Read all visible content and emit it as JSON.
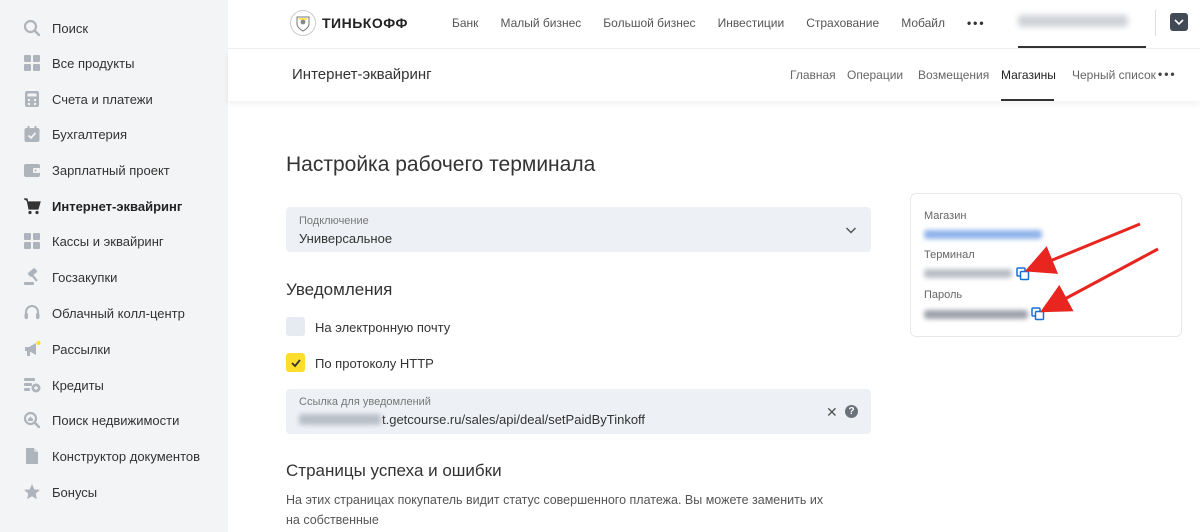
{
  "sidebar": {
    "items": [
      {
        "label": "Поиск",
        "icon": "search-icon"
      },
      {
        "label": "Все продукты",
        "icon": "grid-icon"
      },
      {
        "label": "Счета и платежи",
        "icon": "calculator-icon"
      },
      {
        "label": "Бухгалтерия",
        "icon": "calendar-check-icon"
      },
      {
        "label": "Зарплатный проект",
        "icon": "wallet-icon"
      },
      {
        "label": "Интернет-эквайринг",
        "icon": "cart-icon",
        "active": true
      },
      {
        "label": "Кассы и эквайринг",
        "icon": "cash-register-icon"
      },
      {
        "label": "Госзакупки",
        "icon": "gavel-icon"
      },
      {
        "label": "Облачный колл-центр",
        "icon": "headset-icon"
      },
      {
        "label": "Рассылки",
        "icon": "megaphone-icon"
      },
      {
        "label": "Кредиты",
        "icon": "credit-icon"
      },
      {
        "label": "Поиск недвижимости",
        "icon": "house-search-icon"
      },
      {
        "label": "Конструктор документов",
        "icon": "document-icon"
      },
      {
        "label": "Бонусы",
        "icon": "star-icon"
      }
    ]
  },
  "header": {
    "logo_text": "ТИНЬКОФФ",
    "nav": [
      "Банк",
      "Малый бизнес",
      "Большой бизнес",
      "Инвестиции",
      "Страхование",
      "Мобайл"
    ],
    "more": "•••"
  },
  "subheader": {
    "title": "Интернет-эквайринг",
    "tabs": [
      {
        "label": "Главная"
      },
      {
        "label": "Операции"
      },
      {
        "label": "Возмещения"
      },
      {
        "label": "Магазины",
        "active": true
      },
      {
        "label": "Черный список"
      }
    ],
    "more": "•••"
  },
  "content": {
    "title": "Настройка рабочего терминала",
    "connection": {
      "label": "Подключение",
      "value": "Универсальное"
    },
    "notifications": {
      "title": "Уведомления",
      "email": {
        "label": "На электронную почту",
        "checked": false
      },
      "http": {
        "label": "По протоколу HTTP",
        "checked": true
      },
      "url": {
        "label": "Ссылка для уведомлений",
        "value_visible": "t.getcourse.ru/sales/api/deal/setPaidByTinkoff"
      }
    },
    "pages": {
      "title": "Страницы успеха и ошибки",
      "description": "На этих страницах покупатель видит статус совершенного платежа. Вы можете заменить их на собственные"
    }
  },
  "card": {
    "shop_label": "Магазин",
    "terminal_label": "Терминал",
    "password_label": "Пароль"
  },
  "colors": {
    "accent_yellow": "#ffdd2d",
    "link_blue": "#1a6fd6",
    "arrow_red": "#e8251f",
    "field_bg": "#edf0f4"
  }
}
